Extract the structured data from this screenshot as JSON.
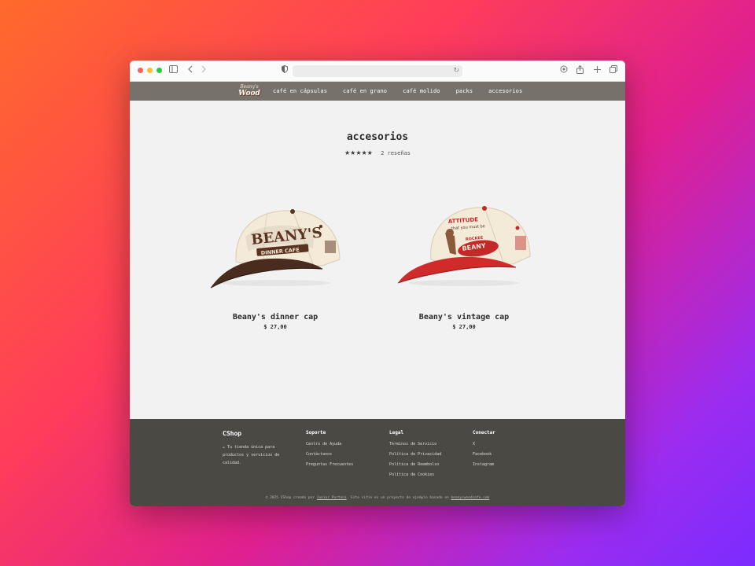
{
  "browser": {
    "reload_glyph": "↻"
  },
  "site": {
    "logo_top": "Beany's",
    "logo_bottom": "Wood",
    "nav": [
      "café en cápsulas",
      "café en grano",
      "café molido",
      "packs",
      "accesorios"
    ]
  },
  "page": {
    "title": "accesorios",
    "stars": "★★★★★",
    "reviews": "2 reseñas"
  },
  "products": [
    {
      "name": "Beany's dinner cap",
      "price": "$ 27,00",
      "cap_text": "BEANY'S",
      "cap_subtext": "DINNER CAFE",
      "crown_color": "#f3ead7",
      "brim_color": "#4a2c1e",
      "accent_color": "#5a3220"
    },
    {
      "name": "Beany's vintage cap",
      "price": "$ 27,00",
      "cap_text": "BEANY",
      "cap_subtext": "",
      "crown_color": "#f3ead7",
      "brim_color": "#d02a2a",
      "accent_color": "#c42828"
    }
  ],
  "footer": {
    "brand": "CShop",
    "tagline": "☕ Tu tienda única para productos y servicios de calidad.",
    "soporte_title": "Soporte",
    "soporte": [
      "Centro de Ayuda",
      "Contáctanos",
      "Preguntas Frecuentes"
    ],
    "legal_title": "Legal",
    "legal": [
      "Términos de Servicio",
      "Política de Privacidad",
      "Política de Reembolso",
      "Política de Cookies"
    ],
    "conectar_title": "Conectar",
    "conectar": [
      "X",
      "Facebook",
      "Instagram"
    ],
    "copyright_prefix": "© 2025 CShop creado por",
    "copyright_author": "Junior Portoni",
    "copyright_mid": ". Este sitio es un proyecto de ejemplo basado en",
    "copyright_link": "beanyswoodcafe.com"
  }
}
